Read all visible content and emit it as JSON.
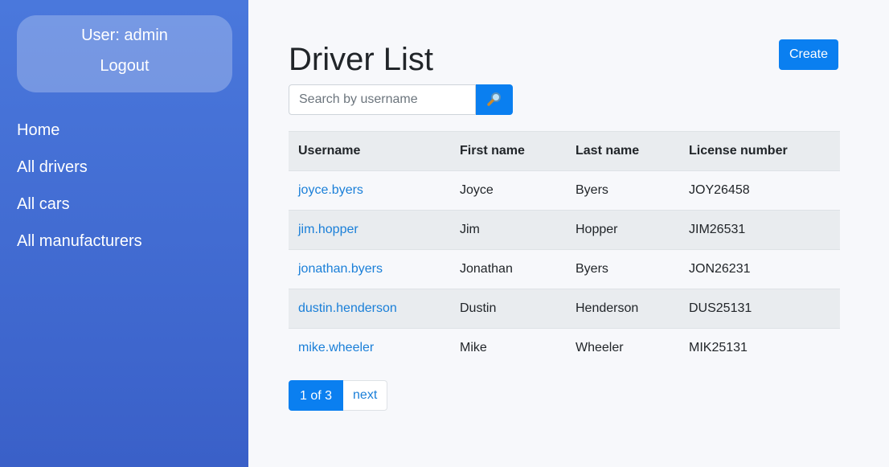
{
  "sidebar": {
    "user_label": "User: admin",
    "logout_label": "Logout",
    "nav": [
      {
        "label": "Home"
      },
      {
        "label": "All drivers"
      },
      {
        "label": "All cars"
      },
      {
        "label": "All manufacturers"
      }
    ]
  },
  "main": {
    "title": "Driver List",
    "create_label": "Create",
    "search": {
      "placeholder": "Search by username",
      "value": "",
      "button_icon": "magnifier-icon"
    },
    "table": {
      "headers": [
        "Username",
        "First name",
        "Last name",
        "License number"
      ],
      "rows": [
        [
          "joyce.byers",
          "Joyce",
          "Byers",
          "JOY26458"
        ],
        [
          "jim.hopper",
          "Jim",
          "Hopper",
          "JIM26531"
        ],
        [
          "jonathan.byers",
          "Jonathan",
          "Byers",
          "JON26231"
        ],
        [
          "dustin.henderson",
          "Dustin",
          "Henderson",
          "DUS25131"
        ],
        [
          "mike.wheeler",
          "Mike",
          "Wheeler",
          "MIK25131"
        ]
      ]
    },
    "pagination": {
      "current": "1 of 3",
      "next": "next"
    }
  },
  "colors": {
    "accent": "#0a7ff0",
    "sidebar": "#4a78dc",
    "link": "#1a7fd8"
  }
}
